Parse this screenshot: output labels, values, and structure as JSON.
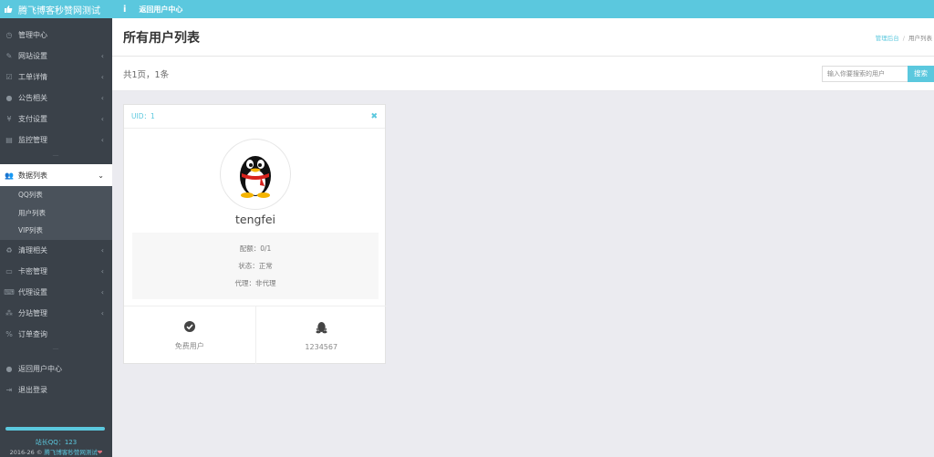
{
  "topbar": {
    "brand": "腾飞博客秒赞网测试",
    "back_label": "返回用户中心"
  },
  "sidebar": {
    "items": [
      {
        "label": "管理中心",
        "icon": "dashboard-icon",
        "chevron": false
      },
      {
        "label": "网站设置",
        "icon": "pencil-icon",
        "chevron": true
      },
      {
        "label": "工单详情",
        "icon": "checkbox-icon",
        "chevron": true
      },
      {
        "label": "公告相关",
        "icon": "info-icon",
        "chevron": true
      },
      {
        "label": "支付设置",
        "icon": "yen-icon",
        "chevron": true
      },
      {
        "label": "监控管理",
        "icon": "monitor-icon",
        "chevron": true
      }
    ],
    "active": {
      "label": "数据列表",
      "icon": "users-icon"
    },
    "sub_items": [
      {
        "label": "QQ列表"
      },
      {
        "label": "用户列表"
      },
      {
        "label": "VIP列表"
      }
    ],
    "items2": [
      {
        "label": "清理相关",
        "icon": "recycle-icon",
        "chevron": true
      },
      {
        "label": "卡密管理",
        "icon": "card-icon",
        "chevron": true
      },
      {
        "label": "代理设置",
        "icon": "keyboard-icon",
        "chevron": true
      },
      {
        "label": "分站管理",
        "icon": "sitemap-icon",
        "chevron": true
      },
      {
        "label": "订单查询",
        "icon": "percent-icon",
        "chevron": false
      }
    ],
    "items3": [
      {
        "label": "返回用户中心",
        "icon": "user-icon"
      },
      {
        "label": "退出登录",
        "icon": "logout-icon"
      }
    ],
    "footer_qq": "站长QQ：123",
    "footer_copy_prefix": "2016-26 © ",
    "footer_copy_site": "腾飞博客秒赞网测试"
  },
  "page": {
    "title": "所有用户列表",
    "breadcrumb_home": "管理后台",
    "breadcrumb_current": "用户列表",
    "summary": "共1页，1条",
    "search_placeholder": "输入你要搜索的用户",
    "search_button": "搜索"
  },
  "card": {
    "uid": "UID：1",
    "username": "tengfei",
    "quota": "配额：0/1",
    "status": "状态：正常",
    "agent": "代理：非代理",
    "user_type": "免费用户",
    "qq": "1234567"
  },
  "colors": {
    "accent": "#5bc8de",
    "sidebar_bg": "#3a4149"
  }
}
